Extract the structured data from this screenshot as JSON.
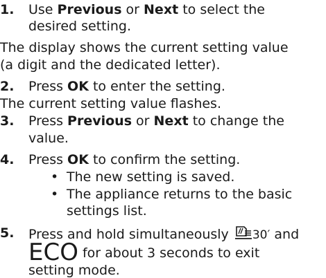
{
  "steps": {
    "s1": {
      "num": "1.",
      "pre": "Use ",
      "b1": "Previous",
      "mid": " or ",
      "b2": "Next",
      "post": " to select the",
      "cont": "desired setting."
    },
    "note1": {
      "line1": "The display shows the current setting value",
      "line2": "(a digit and the dedicated letter)."
    },
    "s2": {
      "num": "2.",
      "pre": "Press ",
      "b1": "OK",
      "post": " to enter the setting."
    },
    "note2": "The current setting value flashes.",
    "s3": {
      "num": "3.",
      "pre": "Press ",
      "b1": "Previous",
      "mid": " or ",
      "b2": "Next",
      "post": " to change the",
      "cont": "value."
    },
    "s4": {
      "num": "4.",
      "pre": "Press ",
      "b1": "OK",
      "post": " to confirm the setting.",
      "bullets": [
        "The new setting is saved.",
        "The appliance returns to the basic",
        "settings list."
      ]
    },
    "s5": {
      "num": "5.",
      "pre": "Press and hold simultaneously ",
      "icon_label": "30′",
      "and": " and",
      "eco": "ECO",
      "post": "for about 3 seconds to exit",
      "cont": "setting mode."
    }
  }
}
